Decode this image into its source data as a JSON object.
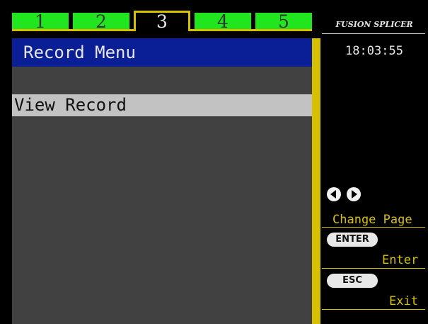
{
  "tabs": [
    "1",
    "2",
    "3",
    "4",
    "5"
  ],
  "active_tab": 3,
  "menu": {
    "title": "Record Menu",
    "items": [
      "View Record"
    ]
  },
  "sidebar": {
    "brand": "FUSION SPLICER",
    "time": "18:03:55",
    "hints": {
      "change_page": "Change Page",
      "enter_key": "ENTER",
      "enter_label": "Enter",
      "esc_key": "ESC",
      "exit_label": "Exit"
    }
  },
  "colors": {
    "tab_green": "#21e61f",
    "accent_yellow": "#d6c000",
    "title_blue": "#0a1e96",
    "panel_gray": "#414141",
    "selection_gray": "#c2c2c2"
  },
  "icons": [
    "arrow-left-icon",
    "arrow-right-icon"
  ]
}
